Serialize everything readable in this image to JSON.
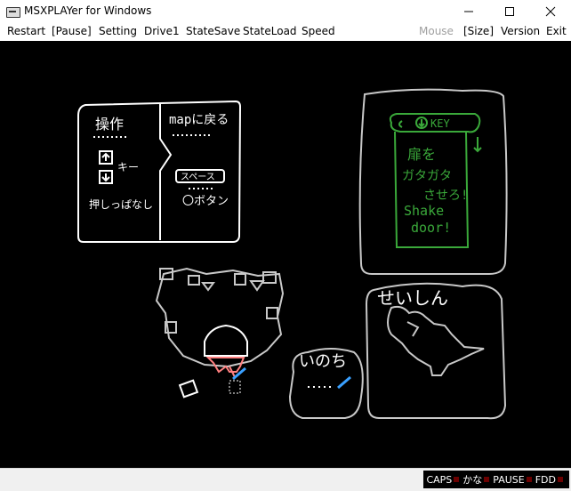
{
  "window": {
    "title": "MSXPLAYer for Windows"
  },
  "menu": {
    "left": [
      "Restart",
      "[Pause]",
      "Setting",
      "Drive1",
      "StateSave",
      "StateLoad",
      "Speed"
    ],
    "mouse": "Mouse",
    "right": [
      "[Size]",
      "Version",
      "Exit"
    ]
  },
  "game": {
    "help_panel": {
      "controls_title": "操作",
      "keys_label": "キー",
      "hold_label": "押しっぱなし",
      "map_label": "mapに戻る",
      "space_label": "スペース",
      "button_label": "〇ボタン"
    },
    "key_panel": {
      "key_label": "KEY",
      "jp_text": [
        "扉を",
        "ガタガタ",
        "させろ!"
      ],
      "en_text": [
        "Shake",
        "door!"
      ]
    },
    "life_label": "いのち",
    "spirit_label": "せいしん",
    "colors": {
      "white": "#ffffff",
      "green": "#3aa83a",
      "gray": "#c8c8c8",
      "pink": "#ff8080",
      "blue": "#3aa0ff"
    }
  },
  "status": {
    "indicators": [
      "CAPS",
      "かな",
      "PAUSE",
      "FDD"
    ],
    "led_color": "#6b0000"
  }
}
